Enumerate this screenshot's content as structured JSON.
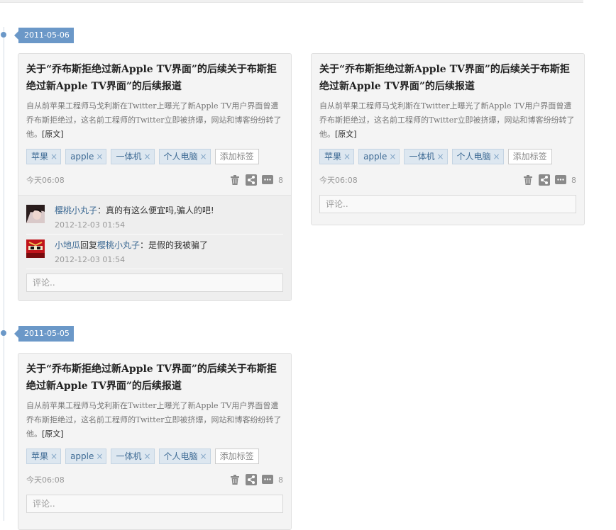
{
  "timeline": [
    {
      "date": "2011-05-06",
      "cards": [
        {
          "title": "关于“乔布斯拒绝过新Apple TV界面”的后续关于布斯拒绝过新Apple TV界面”的后续报道",
          "text": "自从前苹果工程师马戈利斯在Twitter上曝光了新Apple TV用户界面曾遭乔布斯拒绝过，这名前工程师的Twitter立即被挤爆，网站和博客纷纷转了他。",
          "source_link": "[原文]",
          "tags": [
            "苹果",
            "apple",
            "一体机",
            "个人电脑"
          ],
          "add_tag_label": "添加标签",
          "time": "今天06:08",
          "count": "8",
          "comments": [
            {
              "user": "樱桃小丸子",
              "sep": "：",
              "reply_label": "",
              "reply_to": "",
              "text": "真的有这么便宜吗,骗人的吧!",
              "time": "2012-12-03 01:54"
            },
            {
              "user": "小地瓜",
              "sep": "",
              "reply_label": "回复",
              "reply_to": "樱桃小丸子",
              "text": "：是假的我被骗了",
              "time": "2012-12-03 01:54"
            }
          ],
          "comment_placeholder": "评论.."
        },
        {
          "title": "关于“乔布斯拒绝过新Apple TV界面”的后续关于布斯拒绝过新Apple TV界面”的后续报道",
          "text": "自从前苹果工程师马戈利斯在Twitter上曝光了新Apple TV用户界面曾遭乔布斯拒绝过，这名前工程师的Twitter立即被挤爆，网站和博客纷纷转了他。",
          "source_link": "[原文]",
          "tags": [
            "苹果",
            "apple",
            "一体机",
            "个人电脑"
          ],
          "add_tag_label": "添加标签",
          "time": "今天06:08",
          "count": "8",
          "comment_placeholder": "评论.."
        }
      ]
    },
    {
      "date": "2011-05-05",
      "cards": [
        {
          "title": "关于“乔布斯拒绝过新Apple TV界面”的后续关于布斯拒绝过新Apple TV界面”的后续报道",
          "text": "自从前苹果工程师马戈利斯在Twitter上曝光了新Apple TV用户界面曾遭乔布斯拒绝过，这名前工程师的Twitter立即被挤爆，网站和博客纷纷转了他。",
          "source_link": "[原文]",
          "tags": [
            "苹果",
            "apple",
            "一体机",
            "个人电脑"
          ],
          "add_tag_label": "添加标签",
          "time": "今天06:08",
          "count": "8",
          "comment_placeholder": "评论.."
        }
      ]
    }
  ],
  "icons": {
    "delete": "trash-icon",
    "share": "share-icon",
    "comment": "comment-icon",
    "remove_tag": "×"
  },
  "colors": {
    "accent": "#6b98c8",
    "tag_bg": "#dde7f0",
    "tag_text": "#3d6a94",
    "card_bg": "#f4f4f4"
  }
}
